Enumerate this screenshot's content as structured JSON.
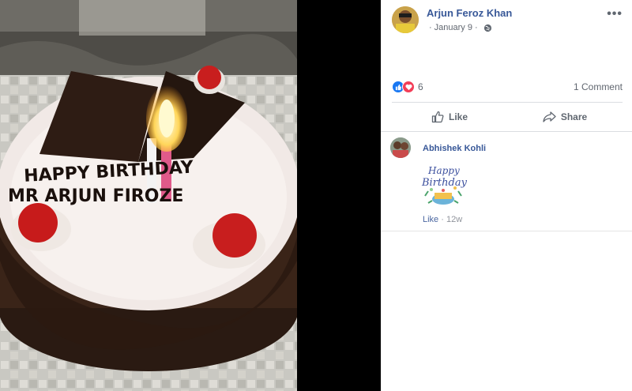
{
  "post": {
    "author": "Arjun Feroz Khan",
    "date": "January 9",
    "separator": "·",
    "privacy_icon": "globe-icon",
    "more_label": "•••"
  },
  "stats": {
    "reaction_icons": [
      "like-icon",
      "love-icon"
    ],
    "reaction_count": "6",
    "comments": "1 Comment"
  },
  "actions": {
    "like_label": "Like",
    "share_label": "Share"
  },
  "comment": {
    "author": "Abhishek Kohli",
    "sticker_text_1": "Happy",
    "sticker_text_2": "Birthday",
    "like_label": "Like",
    "separator": "·",
    "age": "12w"
  },
  "photo": {
    "cake_line_1": "HAPPY BIRTHDAY",
    "cake_line_2": "MR ARJUN FIROZE"
  },
  "colors": {
    "link_blue": "#385898",
    "like_blue": "#1877f2",
    "love_red": "#f33e58"
  }
}
